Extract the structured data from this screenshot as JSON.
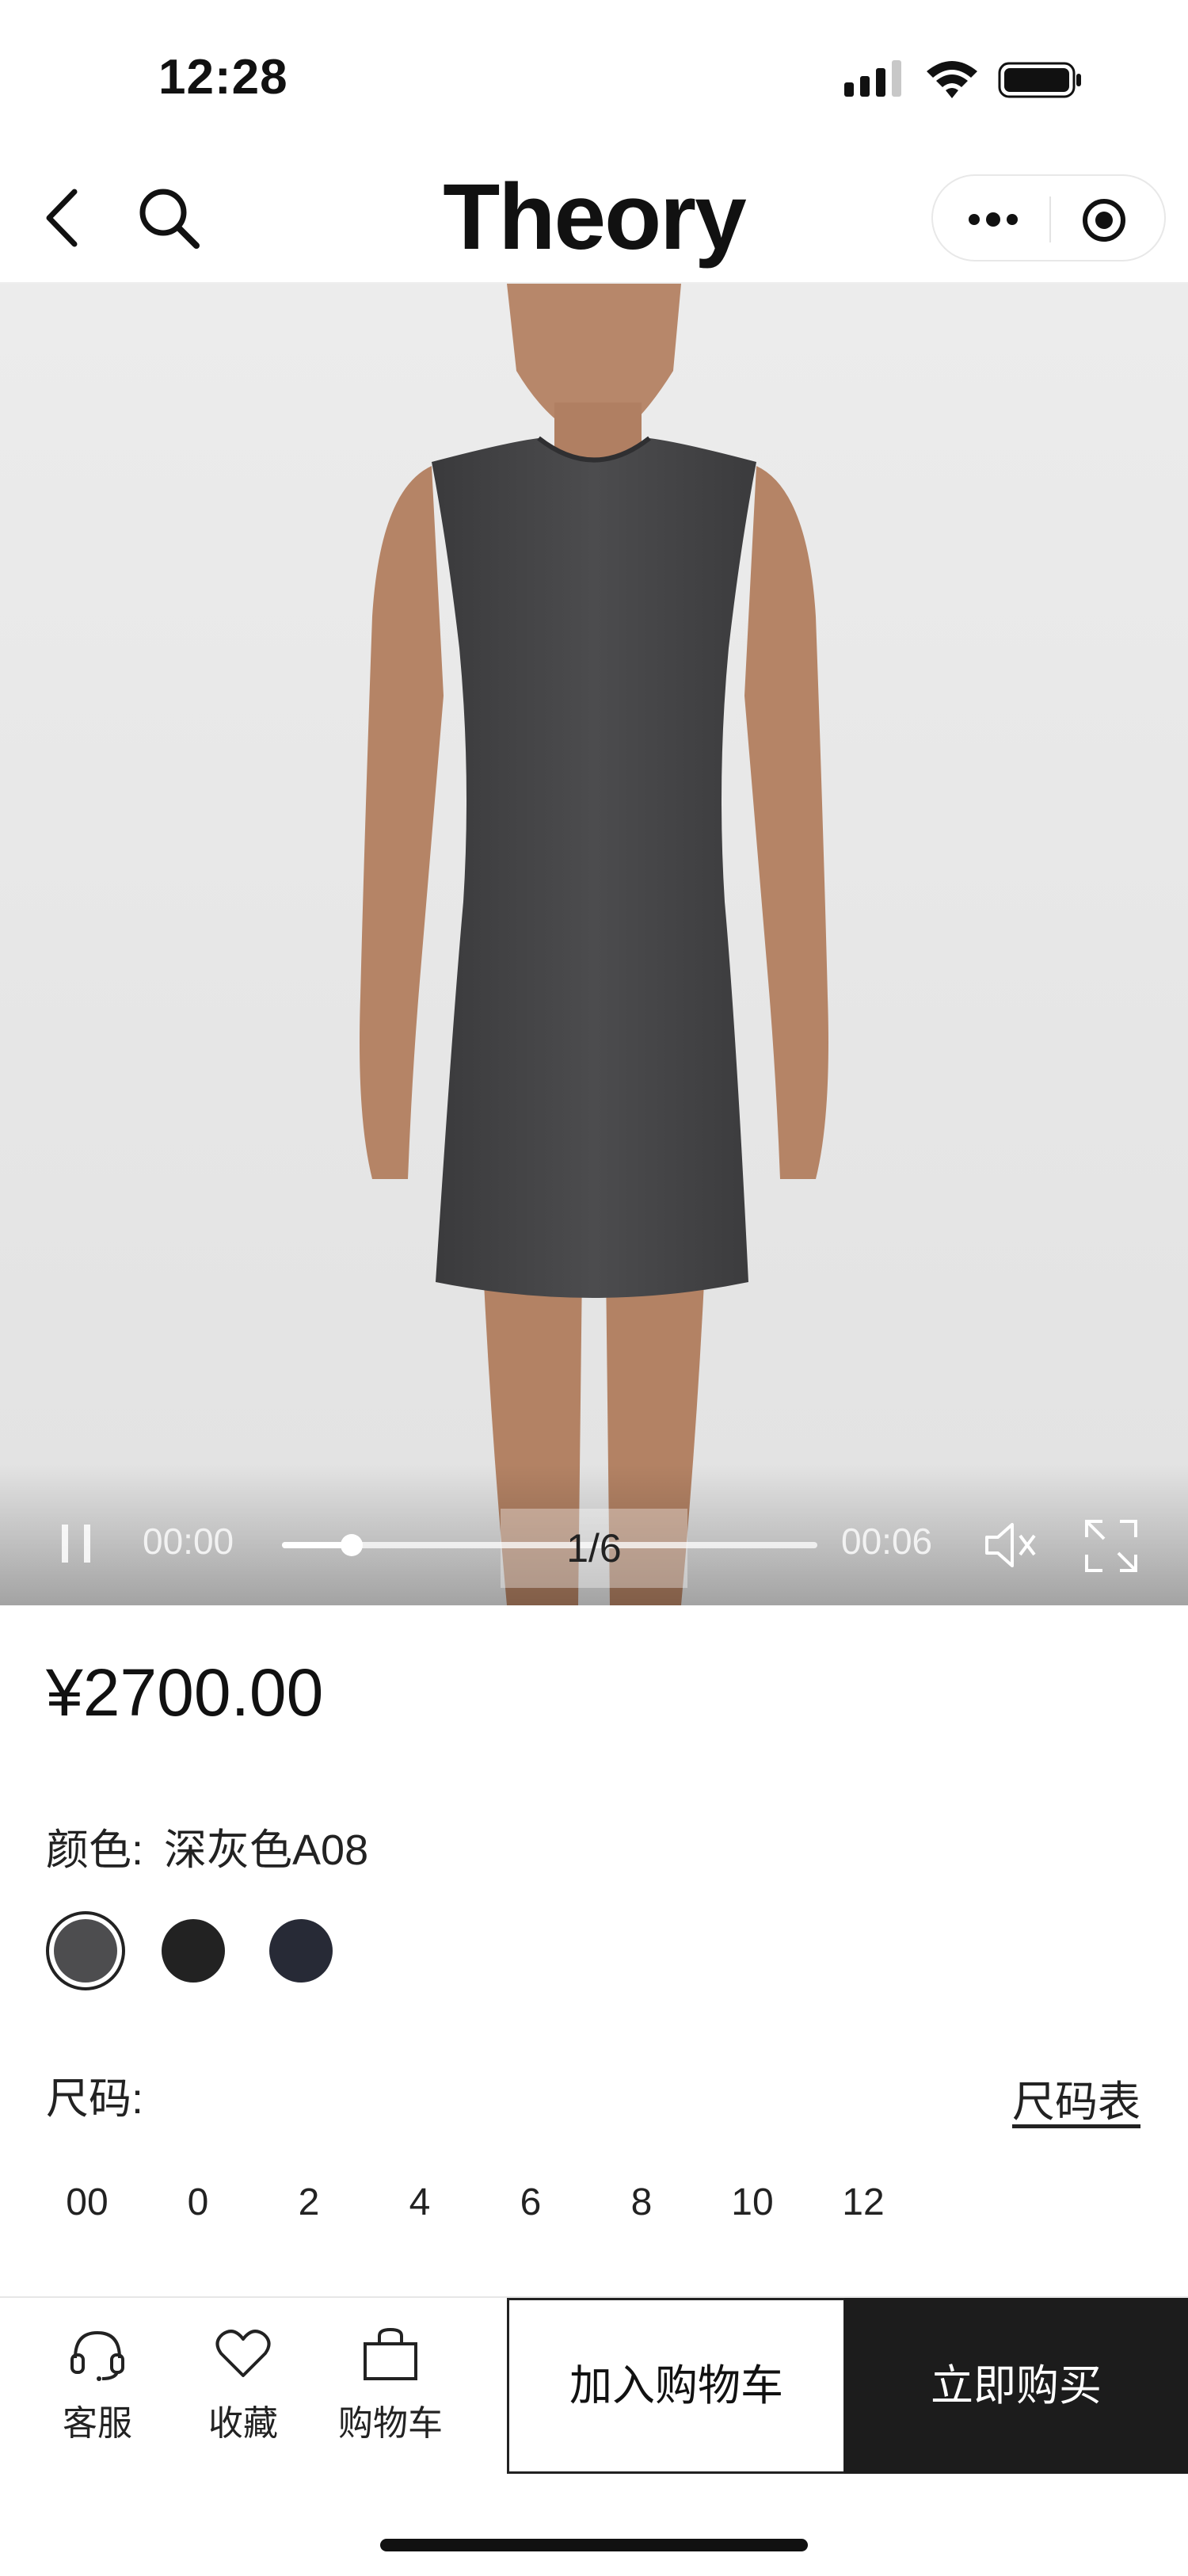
{
  "status_bar": {
    "time": "12:28"
  },
  "nav": {
    "brand": "Theory"
  },
  "media": {
    "current_time": "00:00",
    "total_time": "00:06",
    "progress": 0.13,
    "pager": "1/6"
  },
  "product": {
    "price": "¥2700.00",
    "color_label": "颜色:",
    "color_value": "深灰色A08",
    "swatches": [
      {
        "color": "#4d4d4f",
        "selected": true
      },
      {
        "color": "#222222",
        "selected": false
      },
      {
        "color": "#272a36",
        "selected": false
      }
    ],
    "size_label": "尺码:",
    "size_chart": "尺码表",
    "sizes": [
      "00",
      "0",
      "2",
      "4",
      "6",
      "8",
      "10",
      "12"
    ]
  },
  "bottom_bar": {
    "service": "客服",
    "favorite": "收藏",
    "cart": "购物车",
    "add_to_cart": "加入购物车",
    "buy_now": "立即购买"
  }
}
